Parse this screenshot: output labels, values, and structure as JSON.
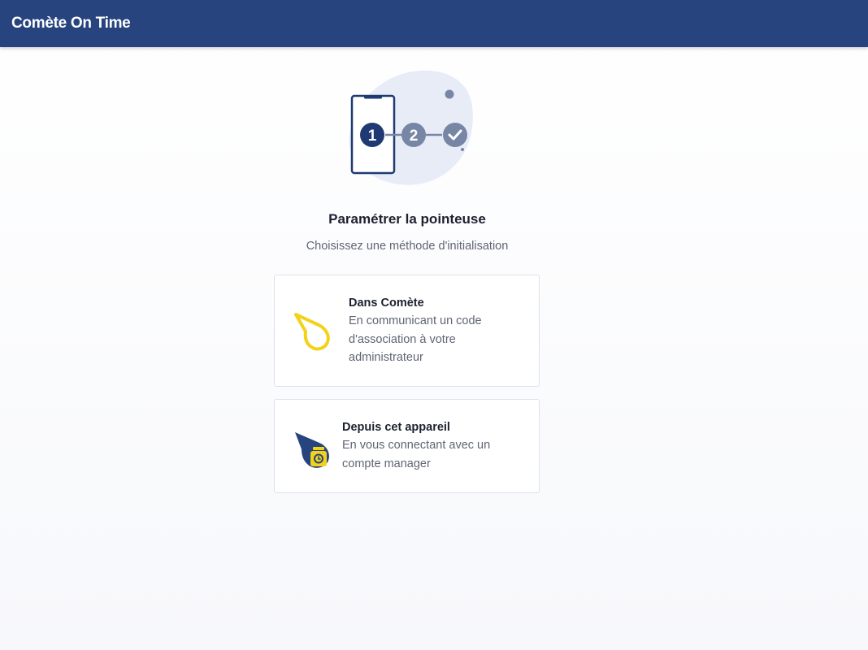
{
  "header": {
    "title": "Comète On Time"
  },
  "illustration": {
    "steps": [
      "1",
      "2"
    ]
  },
  "setup": {
    "title": "Paramétrer la pointeuse",
    "subtitle": "Choisissez une méthode d'initialisation"
  },
  "options": [
    {
      "title": "Dans Comète",
      "description": "En communicant un code d'association à votre administrateur",
      "icon": "comet-outline-icon"
    },
    {
      "title": "Depuis cet appareil",
      "description": "En vous connectant avec un compte manager",
      "icon": "comet-timer-icon"
    }
  ],
  "colors": {
    "header_bg": "#27447f",
    "step_active": "#1f3a73",
    "step_inactive": "#7886a6",
    "accent_yellow": "#f3d21a",
    "blob": "#e8ecf7"
  }
}
